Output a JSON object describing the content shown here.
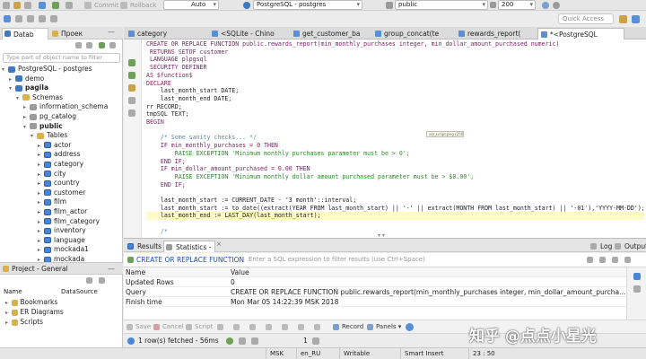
{
  "toolbar": {
    "commit": "Commit",
    "rollback": "Rollback",
    "transaction_mode": "Auto",
    "connection": "PostgreSQL - postgres",
    "schema": "public",
    "limit": "200"
  },
  "quick_access": "Quick Access",
  "navigator": {
    "tabs": [
      "Datab",
      "Проек"
    ],
    "filter_placeholder": "Type part of object name to filter",
    "tree": [
      {
        "label": "PostgreSQL - postgres",
        "level": 0,
        "icon": "database-icon",
        "arrow": "▾"
      },
      {
        "label": "demo",
        "level": 1,
        "icon": "database-icon",
        "arrow": "▸"
      },
      {
        "label": "pagila",
        "level": 1,
        "icon": "database-icon",
        "arrow": "▾",
        "bold": true
      },
      {
        "label": "Schemas",
        "level": 2,
        "icon": "folder-icon",
        "arrow": "▾"
      },
      {
        "label": "information_schema",
        "level": 3,
        "icon": "schema-icon",
        "arrow": "▸"
      },
      {
        "label": "pg_catalog",
        "level": 3,
        "icon": "schema-icon",
        "arrow": "▸"
      },
      {
        "label": "public",
        "level": 3,
        "icon": "schema-icon",
        "arrow": "▾",
        "bold": true
      },
      {
        "label": "Tables",
        "level": 4,
        "icon": "folder-icon",
        "arrow": "▾"
      },
      {
        "label": "actor",
        "level": 5,
        "icon": "table-icon",
        "arrow": "▸"
      },
      {
        "label": "address",
        "level": 5,
        "icon": "table-icon",
        "arrow": "▸"
      },
      {
        "label": "category",
        "level": 5,
        "icon": "table-icon",
        "arrow": "▸"
      },
      {
        "label": "city",
        "level": 5,
        "icon": "table-icon",
        "arrow": "▸"
      },
      {
        "label": "country",
        "level": 5,
        "icon": "table-icon",
        "arrow": "▸"
      },
      {
        "label": "customer",
        "level": 5,
        "icon": "table-icon",
        "arrow": "▸"
      },
      {
        "label": "film",
        "level": 5,
        "icon": "table-icon",
        "arrow": "▸"
      },
      {
        "label": "film_actor",
        "level": 5,
        "icon": "table-icon",
        "arrow": "▸"
      },
      {
        "label": "film_category",
        "level": 5,
        "icon": "table-icon",
        "arrow": "▸"
      },
      {
        "label": "inventory",
        "level": 5,
        "icon": "table-icon",
        "arrow": "▸"
      },
      {
        "label": "language",
        "level": 5,
        "icon": "table-icon",
        "arrow": "▸"
      },
      {
        "label": "mockada1",
        "level": 5,
        "icon": "table-icon",
        "arrow": "▸"
      },
      {
        "label": "mockada",
        "level": 5,
        "icon": "table-icon",
        "arrow": "▸"
      }
    ]
  },
  "project": {
    "title": "Project - General",
    "col_name": "Name",
    "col_source": "DataSource",
    "items": [
      "Bookmarks",
      "ER Diagrams",
      "Scripts"
    ]
  },
  "editor_tabs": [
    {
      "label": "category",
      "active": false
    },
    {
      "label": "<SQLite - Chino",
      "active": false
    },
    {
      "label": "get_customer_ba",
      "active": false
    },
    {
      "label": "group_concat(te",
      "active": false
    },
    {
      "label": "rewards_report(",
      "active": false
    },
    {
      "label": "*<PostgreSQL",
      "active": true
    }
  ],
  "code_lines": [
    "CREATE OR REPLACE FUNCTION public.rewards_report(min_monthly_purchases integer, min_dollar_amount_purchased numeric)",
    " RETURNS SETOF customer",
    " LANGUAGE plpgsql",
    " SECURITY DEFINER",
    "AS $function$",
    "DECLARE",
    "    last_month_start DATE;",
    "    last_month_end DATE;",
    "rr RECORD;",
    "tmpSQL TEXT;",
    "BEGIN",
    "",
    "    /* Some sanity checks... */",
    "    IF min_monthly_purchases = 0 THEN",
    "        RAISE EXCEPTION 'Minimum monthly purchases parameter must be > 0';",
    "    END IF;",
    "    IF min_dollar_amount_purchased = 0.00 THEN",
    "        RAISE EXCEPTION 'Minimum monthly dollar amount purchased parameter must be > $0.00';",
    "    END IF;",
    "",
    "    last_month_start := CURRENT_DATE - '3 month'::interval;",
    "    last_month_start := to_date((extract(YEAR FROM last_month_start) || '-' || extract(MONTH FROM last_month_start) || '-01'),'YYYY-MM-DD');",
    "    last_month_end := LAST_DAY(last_month_start);",
    "",
    "    /*"
  ],
  "tooltip": "sql_script.png (2560×1372)",
  "results": {
    "tabs": [
      "Results",
      "Statistics - 2"
    ],
    "log": "Log",
    "output": "Output",
    "query_label": "CREATE OR REPLACE FUNCTION",
    "filter_placeholder": "Enter a SQL expression to filter results (use Ctrl+Space)",
    "columns": [
      "Name",
      "Value"
    ],
    "rows": [
      {
        "name": "Updated Rows",
        "value": "0"
      },
      {
        "name": "Query",
        "value": "CREATE OR REPLACE FUNCTION public.rewards_report(min_monthly_purchases integer, min_dollar_amount_purcha..."
      },
      {
        "name": "Finish time",
        "value": "Mon Mar 05 14:22:39 MSK 2018"
      }
    ],
    "actions": {
      "save": "Save",
      "cancel": "Cancel",
      "script": "Script",
      "record": "Record",
      "panels": "Panels"
    },
    "fetched": "1 row(s) fetched - 56ms",
    "fetch_count": "1"
  },
  "status": {
    "tz": "MSK",
    "locale": "en_RU",
    "mode": "Writable",
    "insert": "Smart Insert",
    "pos": "23 : 50"
  },
  "watermark": "知乎 @点点小星光",
  "colors": {
    "accent": "#3d78c4",
    "keyword": "#7b1e63",
    "string": "#2a8a2a",
    "comment": "#5f8ba8"
  }
}
